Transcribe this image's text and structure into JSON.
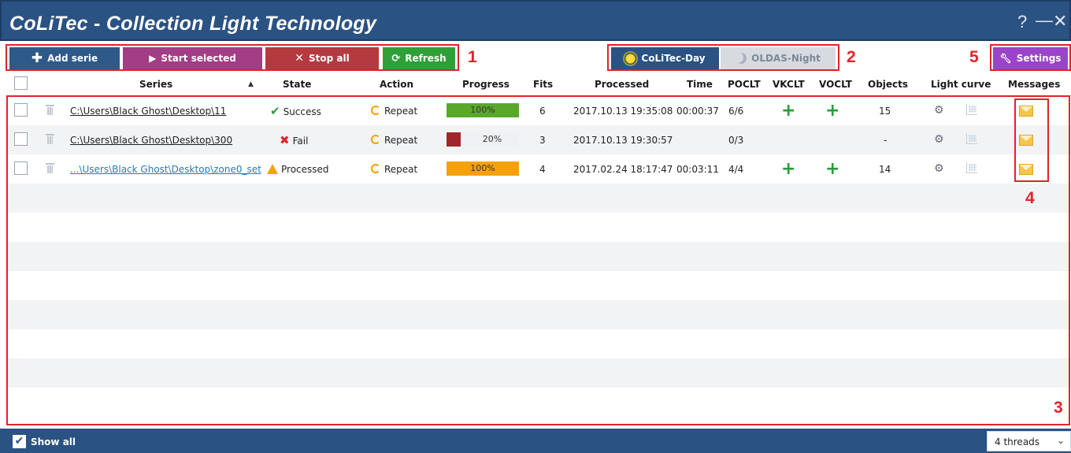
{
  "window": {
    "title": "CoLiTec - Collection Light Technology",
    "help_glyph": "?",
    "min_glyph": "—",
    "close_glyph": "✕"
  },
  "toolbar": {
    "add_serie": "Add serie",
    "start_selected": "Start selected",
    "stop_all": "Stop all",
    "refresh": "Refresh",
    "mode_day": "CoLiTec-Day",
    "mode_night": "OLDAS-Night",
    "settings": "Settings"
  },
  "annotations": [
    "1",
    "2",
    "3",
    "4",
    "5"
  ],
  "table": {
    "columns": [
      "Series",
      "State",
      "Action",
      "Progress",
      "Fits",
      "Processed",
      "Time",
      "POCLT",
      "VKCLT",
      "VOCLT",
      "Objects",
      "Light curve",
      "Messages"
    ],
    "rows": [
      {
        "series": "C:\\Users\\Black Ghost\\Desktop\\11",
        "state": "Success",
        "action": "Repeat",
        "progress": "100%",
        "progress_value": 1.0,
        "fits": "6",
        "processed": "2017.10.13 19:35:08",
        "time": "00:00:37",
        "poclt": "6/6",
        "vkclt": "+",
        "voclt": "+",
        "objects": "15"
      },
      {
        "series": "C:\\Users\\Black Ghost\\Desktop\\300",
        "state": "Fail",
        "action": "Repeat",
        "progress": "20%",
        "progress_value": 0.2,
        "fits": "3",
        "processed": "2017.10.13 19:30:57",
        "time": "",
        "poclt": "0/3",
        "vkclt": "",
        "voclt": "",
        "objects": "-"
      },
      {
        "series": "...\\Users\\Black Ghost\\Desktop\\zone0_set",
        "state": "Processed",
        "action": "Repeat",
        "progress": "100%",
        "progress_value": 1.0,
        "fits": "4",
        "processed": "2017.02.24 18:17:47",
        "time": "00:03:11",
        "poclt": "4/4",
        "vkclt": "+",
        "voclt": "+",
        "objects": "14"
      }
    ]
  },
  "statusbar": {
    "show_all": "Show all",
    "show_all_checked": true,
    "threads": "4 threads"
  },
  "colors": {
    "title_bar": "#2a5283",
    "add_serie": "#2e5a8a",
    "start_selected": "#a23d86",
    "stop_all": "#b43a3f",
    "refresh": "#2fa037",
    "settings": "#9a44c9",
    "progress_success": "#5aa82a",
    "progress_fail": "#a3252a",
    "progress_processed": "#f5a10a",
    "annotation": "#e0232a"
  }
}
